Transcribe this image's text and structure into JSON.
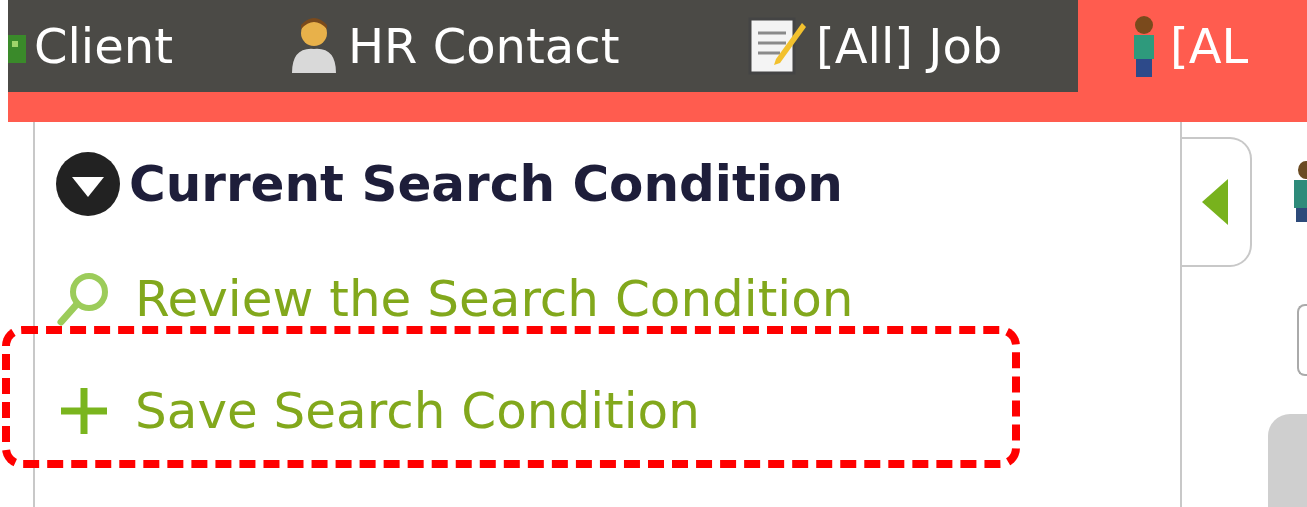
{
  "tabs": [
    {
      "kind": "client",
      "label": "Client",
      "selected": false
    },
    {
      "kind": "contact",
      "label": "HR Contact",
      "selected": false
    },
    {
      "kind": "job",
      "label": "[All] Job",
      "selected": false
    },
    {
      "kind": "candidate",
      "label": "[AL",
      "selected": true
    }
  ],
  "panel": {
    "title": "Current Search Condition",
    "expanded": true,
    "links": [
      {
        "kind": "review",
        "label": "Review the Search Condition",
        "highlighted": false
      },
      {
        "kind": "save",
        "label": "Save Search Condition",
        "highlighted": true
      }
    ]
  }
}
